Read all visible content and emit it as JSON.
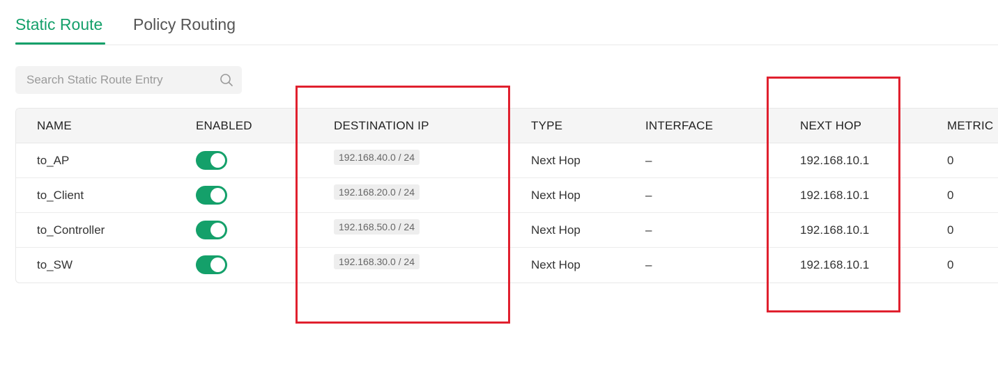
{
  "tabs": [
    {
      "label": "Static Route",
      "active": true
    },
    {
      "label": "Policy Routing",
      "active": false
    }
  ],
  "search": {
    "placeholder": "Search Static Route Entry",
    "icon": "search-icon"
  },
  "table": {
    "headers": {
      "name": "NAME",
      "enabled": "ENABLED",
      "destination_ip": "DESTINATION IP",
      "type": "TYPE",
      "interface": "INTERFACE",
      "next_hop": "NEXT HOP",
      "metric": "METRIC"
    },
    "rows": [
      {
        "name": "to_AP",
        "enabled": true,
        "destination_ip": "192.168.40.0 / 24",
        "type": "Next Hop",
        "interface": "–",
        "next_hop": "192.168.10.1",
        "metric": "0"
      },
      {
        "name": "to_Client",
        "enabled": true,
        "destination_ip": "192.168.20.0 / 24",
        "type": "Next Hop",
        "interface": "–",
        "next_hop": "192.168.10.1",
        "metric": "0"
      },
      {
        "name": "to_Controller",
        "enabled": true,
        "destination_ip": "192.168.50.0 / 24",
        "type": "Next Hop",
        "interface": "–",
        "next_hop": "192.168.10.1",
        "metric": "0"
      },
      {
        "name": "to_SW",
        "enabled": true,
        "destination_ip": "192.168.30.0 / 24",
        "type": "Next Hop",
        "interface": "–",
        "next_hop": "192.168.10.1",
        "metric": "0"
      }
    ]
  },
  "colors": {
    "accent": "#14a06a",
    "highlight": "#e0202e"
  }
}
